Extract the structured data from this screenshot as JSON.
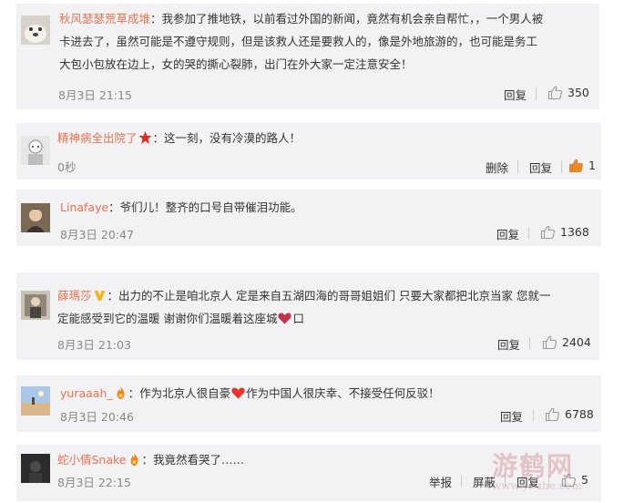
{
  "comments": [
    {
      "user": "秋风瑟瑟荒草成堆",
      "lines": [
        "：我参加了推地铁，以前看过外国的新闻，竟然有机会亲自帮忙，，一个男人被",
        "卡进去了，虽然可能是不遵守规则，但是该救人还是要救人的，像是外地旅游的，也可能是务工",
        "大包小包放在边上，女的哭的撕心裂肺，出门在外大家一定注意安全！"
      ],
      "time": "8月3日 21:15",
      "reply": "回复",
      "likes": "350"
    },
    {
      "user": "精神病全出院了",
      "lines": [
        "：这一刻，没有冷漠的路人！"
      ],
      "time": "0秒",
      "delete": "删除",
      "reply": "回复",
      "likes": "1"
    },
    {
      "user": "Linafaye",
      "lines": [
        "：爷们儿！整齐的口号自带催泪功能。"
      ],
      "time": "8月3日 20:47",
      "reply": "回复",
      "likes": "1368"
    },
    {
      "user": "薛瑪莎",
      "lines": [
        "：出力的不止是咱北京人 定是来自五湖四海的哥哥姐姐们 只要大家都把北京当家 您就一",
        "定能感受到它的温暖 谢谢你们温暖着这座城",
        "口"
      ],
      "time": "8月3日 21:03",
      "reply": "回复",
      "likes": "2404"
    },
    {
      "user": "yuraaah_",
      "lines": [
        "：作为北京人很自豪",
        "作为中国人很庆幸、不接受任何反驳！"
      ],
      "time": "8月3日 20:46",
      "reply": "回复",
      "likes": "6788"
    },
    {
      "user": "蛇小倩Snake",
      "lines": [
        "：我竟然看哭了……"
      ],
      "time": "8月3日 22:15",
      "report": "举报",
      "block": "屏蔽",
      "reply": "回复",
      "likes": "5"
    }
  ],
  "watermark": {
    "big": "游鹤网",
    "small": "www.youhe.com"
  },
  "colors": {
    "username": "#eb7350",
    "card_bg": "#f2f2f5",
    "liked_icon": "#f08a24"
  },
  "icons": [
    "thumbs-up-icon",
    "red-star-badge-icon",
    "v-badge-icon",
    "flame-emoji-icon",
    "heart-emoji-icon"
  ]
}
